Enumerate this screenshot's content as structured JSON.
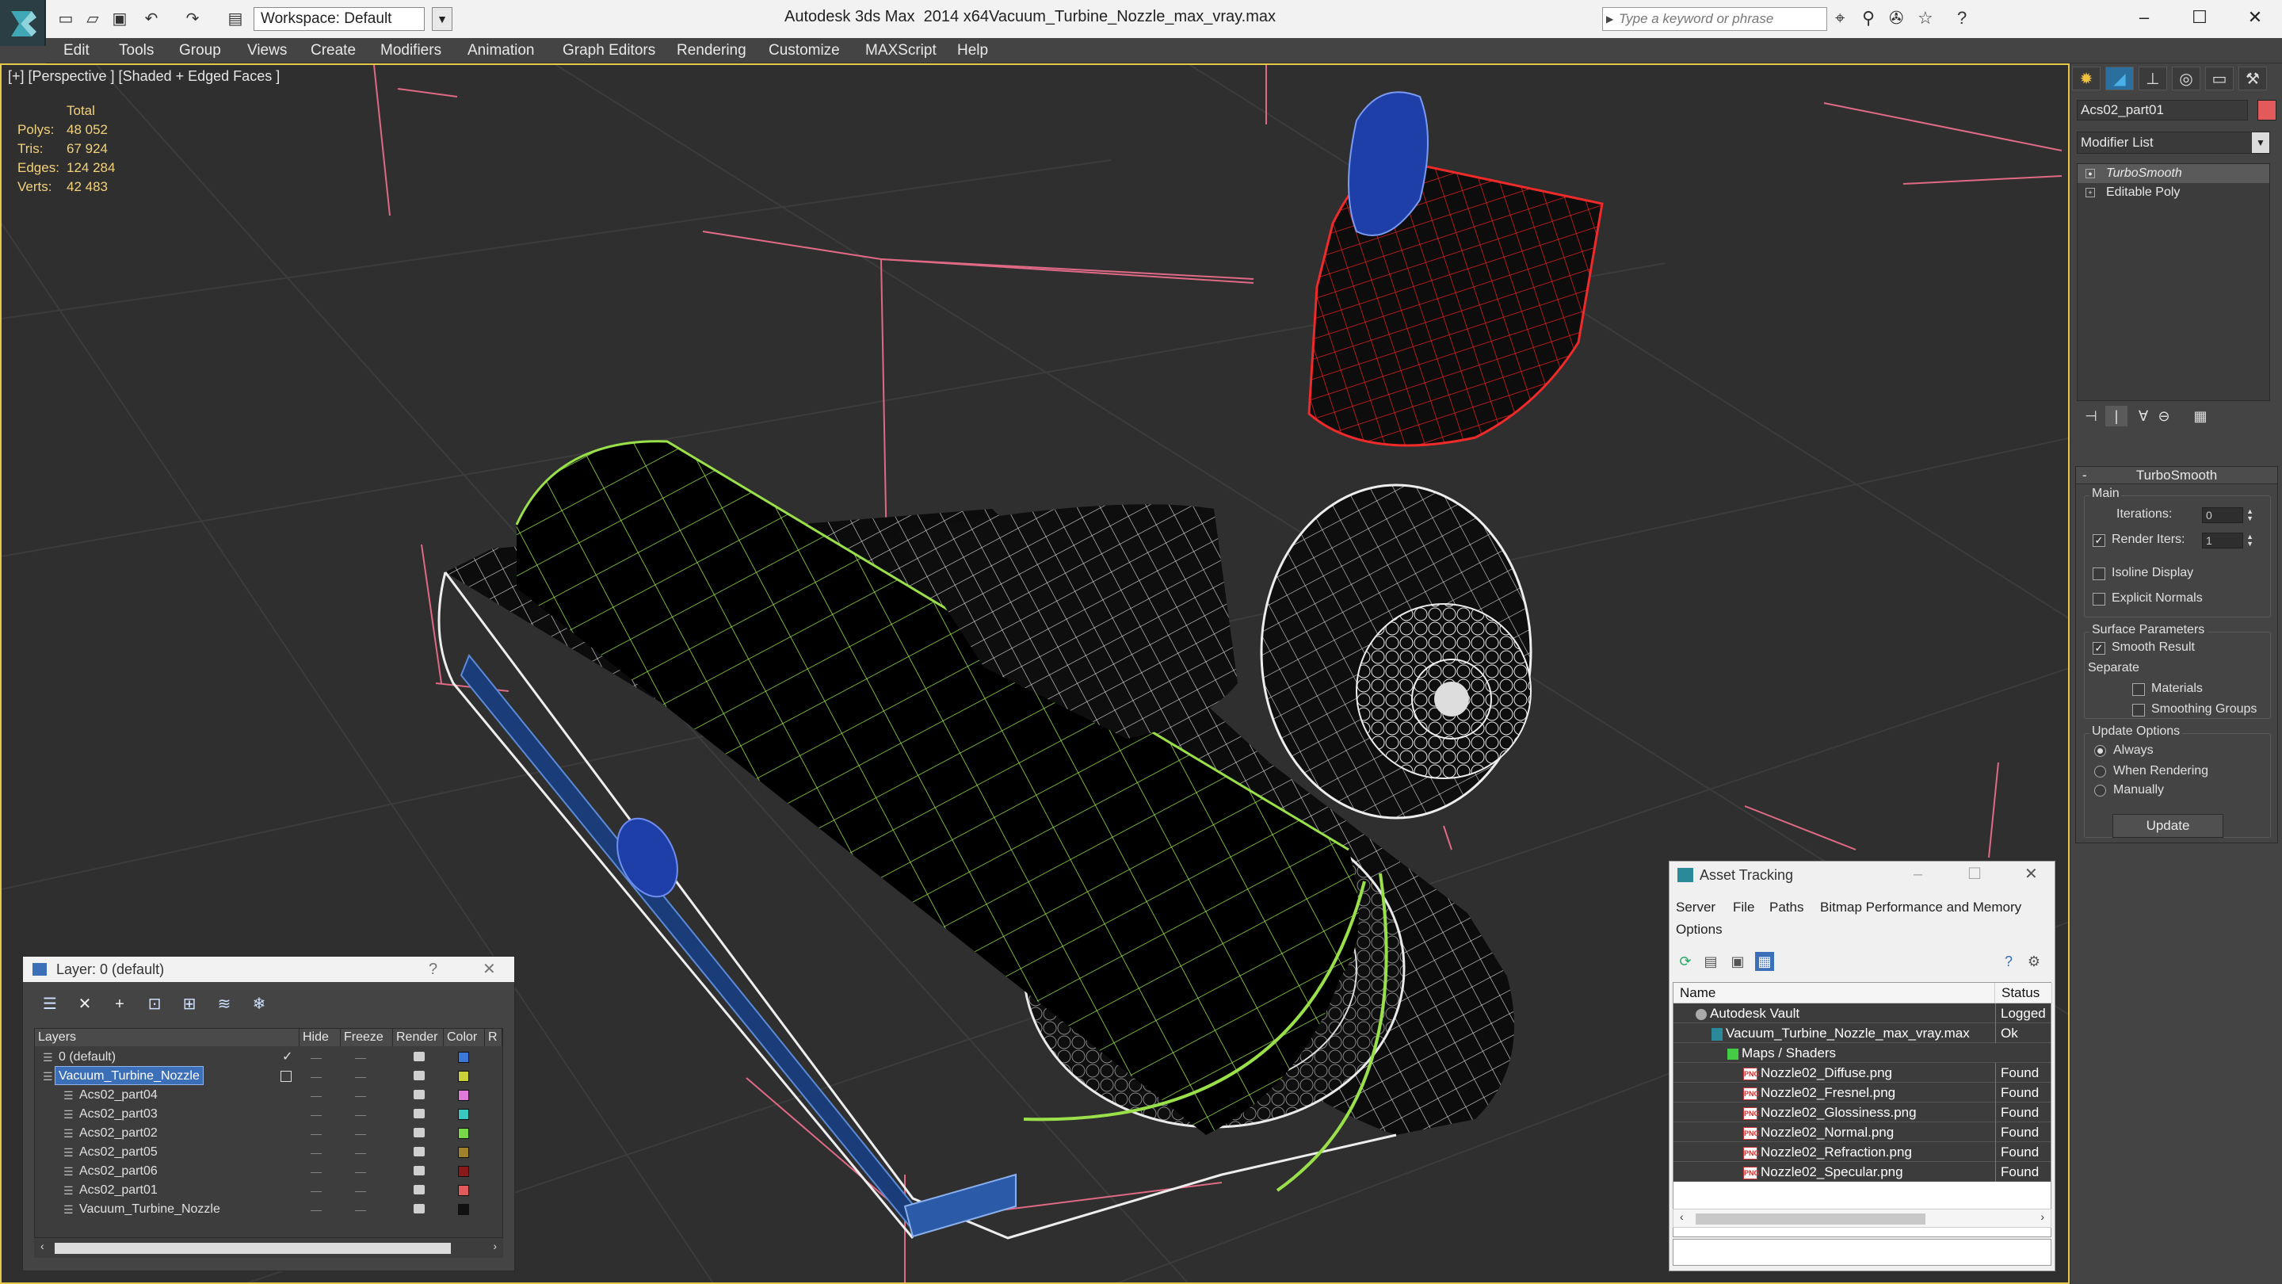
{
  "titlebar": {
    "app_title": "Autodesk 3ds Max  2014 x64",
    "file_title": "Vacuum_Turbine_Nozzle_max_vray.max",
    "workspace": "Workspace: Default",
    "search_placeholder": "Type a keyword or phrase"
  },
  "menu": [
    "Edit",
    "Tools",
    "Group",
    "Views",
    "Create",
    "Modifiers",
    "Animation",
    "Graph Editors",
    "Rendering",
    "Customize",
    "MAXScript",
    "Help"
  ],
  "viewport": {
    "label": "[+] [Perspective ] [Shaded + Edged Faces ]",
    "stats": {
      "header": "Total",
      "rows": [
        {
          "k": "Polys:",
          "v": "48 052"
        },
        {
          "k": "Tris:",
          "v": "67 924"
        },
        {
          "k": "Edges:",
          "v": "124 284"
        },
        {
          "k": "Verts:",
          "v": "42 483"
        }
      ]
    }
  },
  "command_panel": {
    "object_name": "Acs02_part01",
    "object_color": "#e25a5a",
    "modifier_list": "Modifier List",
    "stack": [
      "TurboSmooth",
      "Editable Poly"
    ],
    "rollout_title": "TurboSmooth",
    "main_label": "Main",
    "iterations_label": "Iterations:",
    "iterations_value": "0",
    "render_iters_label": "Render Iters:",
    "render_iters_value": "1",
    "isoline_label": "Isoline Display",
    "explicit_label": "Explicit Normals",
    "surface_label": "Surface Parameters",
    "smooth_label": "Smooth Result",
    "separate_label": "Separate",
    "materials_label": "Materials",
    "smoothing_label": "Smoothing Groups",
    "update_label": "Update Options",
    "always_label": "Always",
    "when_render_label": "When Rendering",
    "manually_label": "Manually",
    "update_button": "Update"
  },
  "layer_dialog": {
    "title": "Layer: 0 (default)",
    "help": "?",
    "columns": {
      "layers": "Layers",
      "hide": "Hide",
      "freeze": "Freeze",
      "render": "Render",
      "color": "Color",
      "r": "R"
    },
    "rows": [
      {
        "name": "0 (default)",
        "color": "#3c78d8",
        "indent": 0
      },
      {
        "name": "Vacuum_Turbine_Nozzle",
        "color": "#c8d03a",
        "indent": 0
      },
      {
        "name": "Acs02_part04",
        "color": "#e07ad8",
        "indent": 1
      },
      {
        "name": "Acs02_part03",
        "color": "#38c8c0",
        "indent": 1
      },
      {
        "name": "Acs02_part02",
        "color": "#78d848",
        "indent": 1
      },
      {
        "name": "Acs02_part05",
        "color": "#a0822c",
        "indent": 1
      },
      {
        "name": "Acs02_part06",
        "color": "#8a1a1a",
        "indent": 1
      },
      {
        "name": "Acs02_part01",
        "color": "#e25a5a",
        "indent": 1
      },
      {
        "name": "Vacuum_Turbine_Nozzle",
        "color": "#111111",
        "indent": 1
      }
    ]
  },
  "asset_dialog": {
    "title": "Asset Tracking",
    "menu": [
      "Server",
      "File",
      "Paths",
      "Bitmap Performance and Memory"
    ],
    "options": "Options",
    "columns": {
      "name": "Name",
      "status": "Status"
    },
    "rows": [
      {
        "name": "Autodesk Vault",
        "status": "Logged",
        "indent": 1
      },
      {
        "name": "Vacuum_Turbine_Nozzle_max_vray.max",
        "status": "Ok",
        "indent": 2
      },
      {
        "name": "Maps / Shaders",
        "status": "",
        "indent": 3
      },
      {
        "name": "Nozzle02_Diffuse.png",
        "status": "Found",
        "indent": 4
      },
      {
        "name": "Nozzle02_Fresnel.png",
        "status": "Found",
        "indent": 4
      },
      {
        "name": "Nozzle02_Glossiness.png",
        "status": "Found",
        "indent": 4
      },
      {
        "name": "Nozzle02_Normal.png",
        "status": "Found",
        "indent": 4
      },
      {
        "name": "Nozzle02_Refraction.png",
        "status": "Found",
        "indent": 4
      },
      {
        "name": "Nozzle02_Specular.png",
        "status": "Found",
        "indent": 4
      }
    ]
  }
}
